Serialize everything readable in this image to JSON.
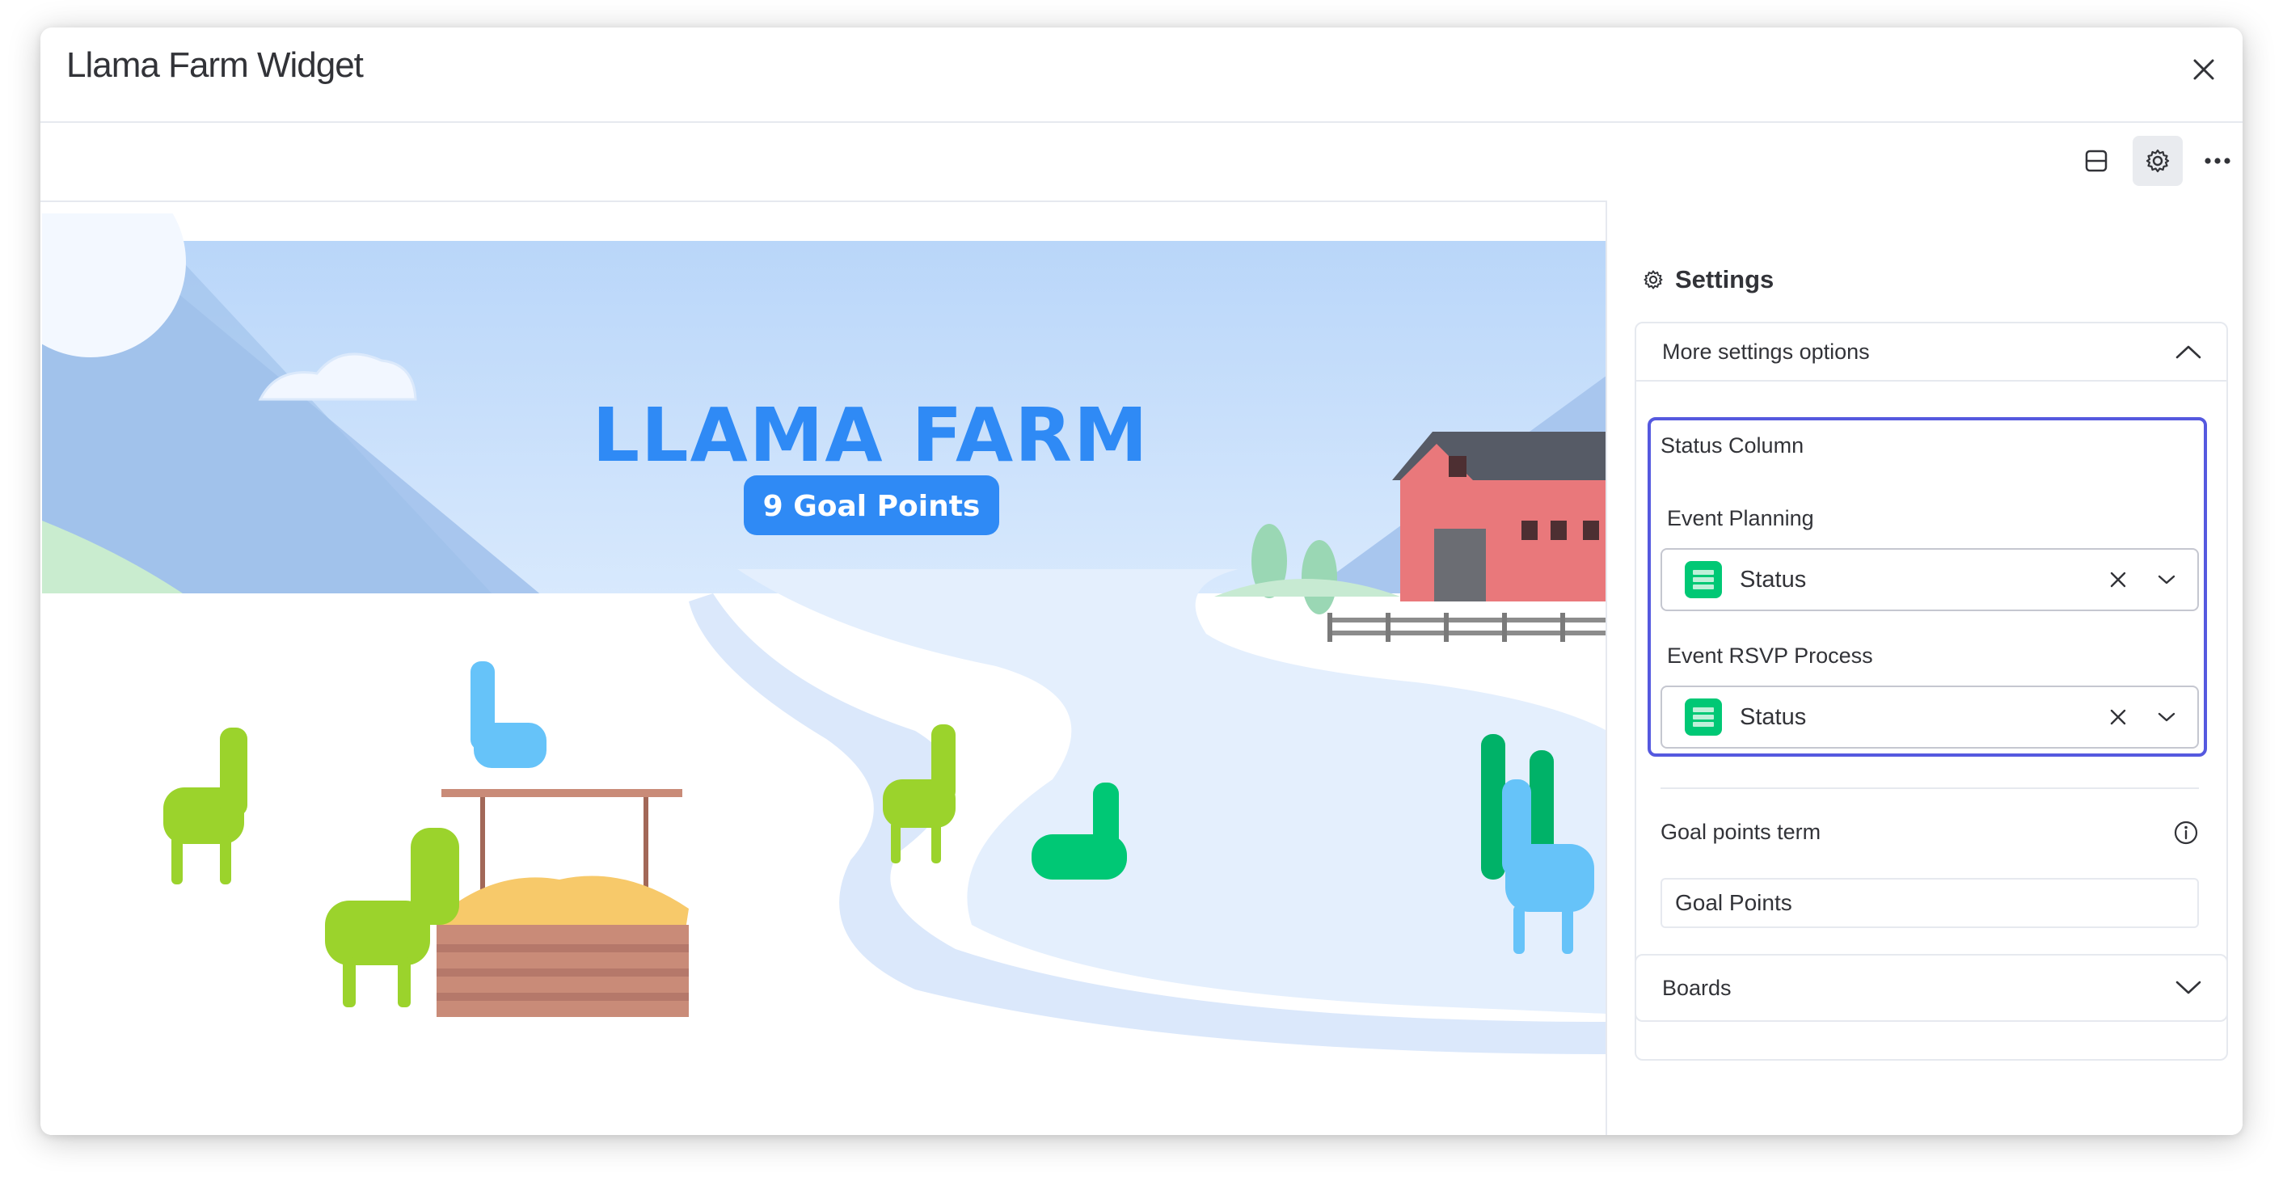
{
  "dialog": {
    "title": "Llama Farm Widget"
  },
  "toolbar": {
    "icons": [
      "layout-icon",
      "gear-icon",
      "more-icon"
    ]
  },
  "widget": {
    "banner_title": "LLAMA FARM",
    "goal_badge": "9 Goal Points"
  },
  "settings": {
    "title": "Settings",
    "more_options": {
      "label": "More settings options",
      "expanded": true
    },
    "status_column": {
      "heading": "Status Column",
      "boards": [
        {
          "name": "Event Planning",
          "selected": "Status"
        },
        {
          "name": "Event RSVP Process",
          "selected": "Status"
        }
      ]
    },
    "goal_points_term": {
      "label": "Goal points term",
      "value": "Goal Points"
    },
    "boards_section": {
      "label": "Boards",
      "expanded": false
    }
  },
  "colors": {
    "accent": "#5559df",
    "status_green": "#00c875",
    "banner_blue": "#2f8af5",
    "sky": "#cfe4fb"
  }
}
